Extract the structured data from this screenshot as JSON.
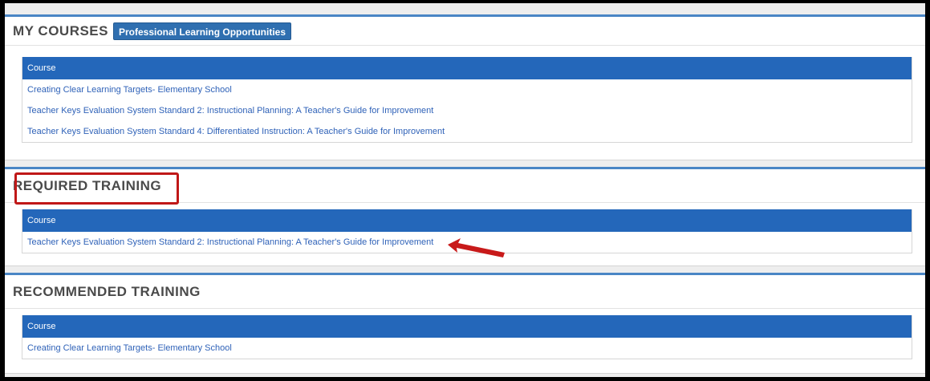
{
  "my_courses": {
    "title": "MY COURSES",
    "button_label": "Professional Learning Opportunities",
    "column_header": "Course",
    "rows": [
      "Creating Clear Learning Targets- Elementary School",
      "Teacher Keys Evaluation System Standard 2: Instructional Planning: A Teacher's Guide for Improvement",
      "Teacher Keys Evaluation System Standard 4: Differentiated Instruction: A Teacher's Guide for Improvement"
    ]
  },
  "required_training": {
    "title": "REQUIRED TRAINING",
    "column_header": "Course",
    "rows": [
      "Teacher Keys Evaluation System Standard 2: Instructional Planning: A Teacher's Guide for Improvement"
    ]
  },
  "recommended_training": {
    "title": "RECOMMENDED TRAINING",
    "column_header": "Course",
    "rows": [
      "Creating Clear Learning Targets- Elementary School"
    ]
  },
  "colors": {
    "header_blue": "#2467ba",
    "link_blue": "#2f62b8",
    "highlight_red": "#c01818"
  },
  "annotations": {
    "highlight_icon": "red-highlight-box",
    "arrow_icon": "red-arrow-icon"
  }
}
